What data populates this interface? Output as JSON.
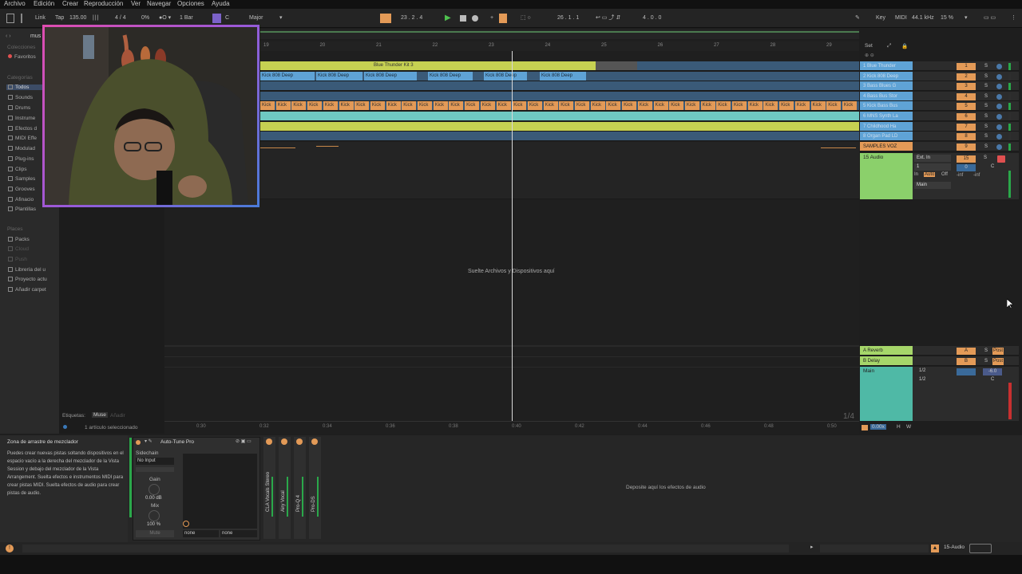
{
  "menu": [
    "Archivo",
    "Edición",
    "Crear",
    "Reproducción",
    "Ver",
    "Navegar",
    "Opciones",
    "Ayuda"
  ],
  "toolbar": {
    "link": "Link",
    "tap": "Tap",
    "tempo": "135.00",
    "signature": "4 / 4",
    "cpu_pct": "0%",
    "bar_quant": "1 Bar",
    "key": "C",
    "scale": "Major",
    "position": "23 .  2 .  4",
    "loop_start": "26 .  1 .  1",
    "loop_len": "4 .  0 .  0",
    "key_label": "Key",
    "midi_label": "MIDI",
    "sample_rate": "44.1 kHz",
    "cpu": "15 %"
  },
  "browser": {
    "collections_header": "Colecciones",
    "favorites": "Favoritos",
    "categories_header": "Categorías",
    "categories": [
      "Todos",
      "Sounds",
      "Drums",
      "Instrume",
      "Efectos d",
      "MIDI Effe",
      "Modulad",
      "Plug-ins",
      "Clips",
      "Samples",
      "Grooves",
      "Afinacio",
      "Plantillas"
    ],
    "places_header": "Places",
    "places": [
      "Packs",
      "Cloud",
      "Push",
      "Librería del u",
      "Proyecto actu",
      "Añadir carpet"
    ],
    "search_value": "mus",
    "tags_label": "Etiquetas:",
    "tag_muse": "Muse",
    "tag_add": "Añadir",
    "selected_count": "1 artículo seleccionado"
  },
  "ruler_bars": [
    "19",
    "20",
    "21",
    "22",
    "23",
    "24",
    "25",
    "26",
    "27",
    "28",
    "29"
  ],
  "time_marks": [
    "0:30",
    "0:32",
    "0:34",
    "0:36",
    "0:38",
    "0:40",
    "0:42",
    "0:44",
    "0:46",
    "0:48",
    "0:50"
  ],
  "set_label": "Set",
  "tracks": [
    {
      "name": "1 Blue Thunder",
      "num": "1"
    },
    {
      "name": "2 Kick 808 Deep",
      "num": "2"
    },
    {
      "name": "3 Bass Blues G",
      "num": "3"
    },
    {
      "name": "4 Bass Bus Stor",
      "num": "4"
    },
    {
      "name": "5 Kick Bass Bus",
      "num": "5"
    },
    {
      "name": "6 MNS Synth La",
      "num": "6"
    },
    {
      "name": "7 Childhood Ha",
      "num": "7"
    },
    {
      "name": "8 Organ Pad LD",
      "num": "8"
    },
    {
      "name": "SAMPLES VOZ",
      "num": "9"
    },
    {
      "name": "15 Audio",
      "num": "15"
    }
  ],
  "clips": {
    "blue_thunder": "Blue Thunder Kit 3",
    "kick_808": "Kick 808 Deep",
    "kick": "Kick"
  },
  "drop_hint": "Suelte Archivos y Dispositivos aquí",
  "audio_track": {
    "input": "Ext. In",
    "channel": "1",
    "monitor_in": "In",
    "monitor_auto": "Auto",
    "monitor_off": "Off",
    "output": "Main",
    "vol": "0",
    "pan": "C",
    "send": "-inf"
  },
  "returns": [
    {
      "name": "A Reverb",
      "letter": "A",
      "post": "Post"
    },
    {
      "name": "B Delay",
      "letter": "B",
      "post": "Post"
    }
  ],
  "main": {
    "name": "Main",
    "in1": "1/2",
    "in2": "1/2",
    "vol": "-6.0",
    "pan": "C"
  },
  "page_indicator": "1/4",
  "zoom": "0.00x",
  "hw": [
    "H",
    "W"
  ],
  "detail": {
    "info_title": "Zona de arrastre de mezclador",
    "info_text": "Puedes crear nuevas pistas soltando dispositivos en el espacio vacío a la derecha del mezclador de la Vista Session y debajo del mezclador de la Vista Arrangement. Suelta efectos e instrumentos MIDI para crear pistas MIDI. Suelta efectos de audio para crear pistas de audio.",
    "device_name": "Auto-Tune Pro",
    "sidechain": "Sidechain",
    "no_input": "No Input",
    "gain": "Gain",
    "gain_value": "0.00 dB",
    "mix": "Mix",
    "mix_value": "100 %",
    "mute": "Mute",
    "none1": "none",
    "none2": "none",
    "chain_names": [
      "CLA Vocals Stereo",
      "Airy Vocal",
      "Pro-Q 4",
      "Pro-DS"
    ],
    "drop_effects": "Deposite aquí los efectos de audio"
  },
  "statusbar": {
    "track": "15-Audio"
  },
  "colors": {
    "accent": "#e39a57",
    "clip_blue": "#5fa3d6",
    "clip_green": "#c6d152",
    "clip_teal": "#6fc9c3",
    "track_green": "#8bd06b",
    "return_green": "#a6d66a",
    "main_teal": "#4fb9a6"
  }
}
